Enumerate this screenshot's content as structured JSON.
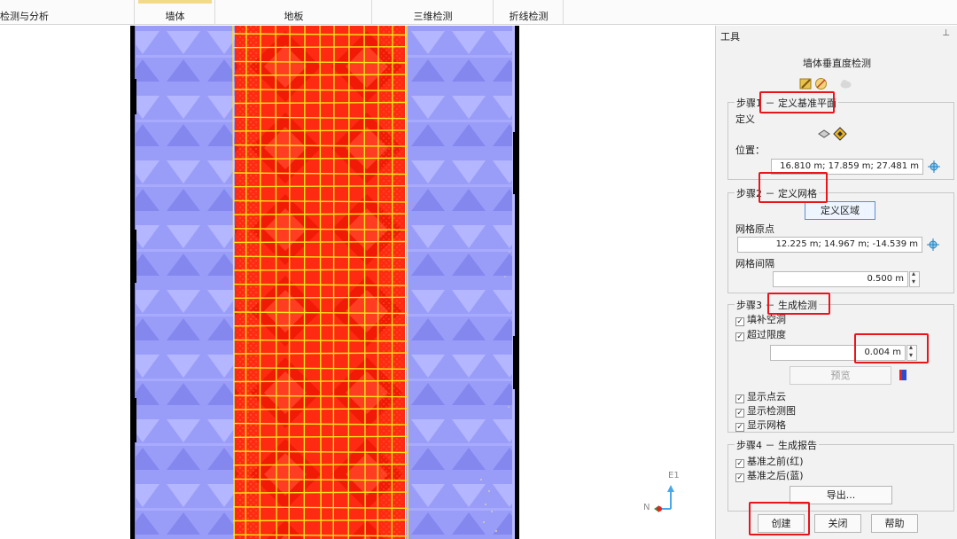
{
  "ribbon": {
    "tabs": [
      {
        "label": "检测与分析"
      },
      {
        "label": "墙体"
      },
      {
        "label": "地板"
      },
      {
        "label": "三维检测"
      },
      {
        "label": "折线检测"
      }
    ]
  },
  "viewport": {
    "axis_labels": {
      "e": "E1",
      "n": "N"
    }
  },
  "panel": {
    "header": "工具",
    "tool_title": "墙体垂直度检测",
    "step1": {
      "title": "步骤1 － 定义基准平面",
      "define_label": "定义",
      "position_label": "位置：",
      "position_value": "16.810 m; 17.859 m; 27.481 m"
    },
    "step2": {
      "title": "步骤2 － 定义网格",
      "define_area_button": "定义区域",
      "grid_origin_label": "网格原点",
      "grid_origin_value": "12.225 m; 14.967 m; -14.539 m",
      "grid_spacing_label": "网格间隔",
      "grid_spacing_value": "0.500 m"
    },
    "step3": {
      "title": "步骤3 － 生成检测",
      "fill_holes_label": "填补空洞",
      "exceed_limit_label": "超过限度",
      "limit_value": "0.004 m",
      "preview_button": "预览",
      "show_point_cloud_label": "显示点云",
      "show_inspection_map_label": "显示检测图",
      "show_grid_label": "显示网格"
    },
    "step4": {
      "title": "步骤4 － 生成报告",
      "before_ref_label": "基准之前(红)",
      "after_ref_label": "基准之后(蓝)",
      "export_button": "导出..."
    },
    "buttons": {
      "create": "创建",
      "close": "关闭",
      "help": "帮助"
    }
  },
  "colors": {
    "wall_blue": "#9a9df8",
    "wall_red": "#ff2a12",
    "grid_yellow": "#ffe41a",
    "highlight_red": "#e8151b"
  }
}
